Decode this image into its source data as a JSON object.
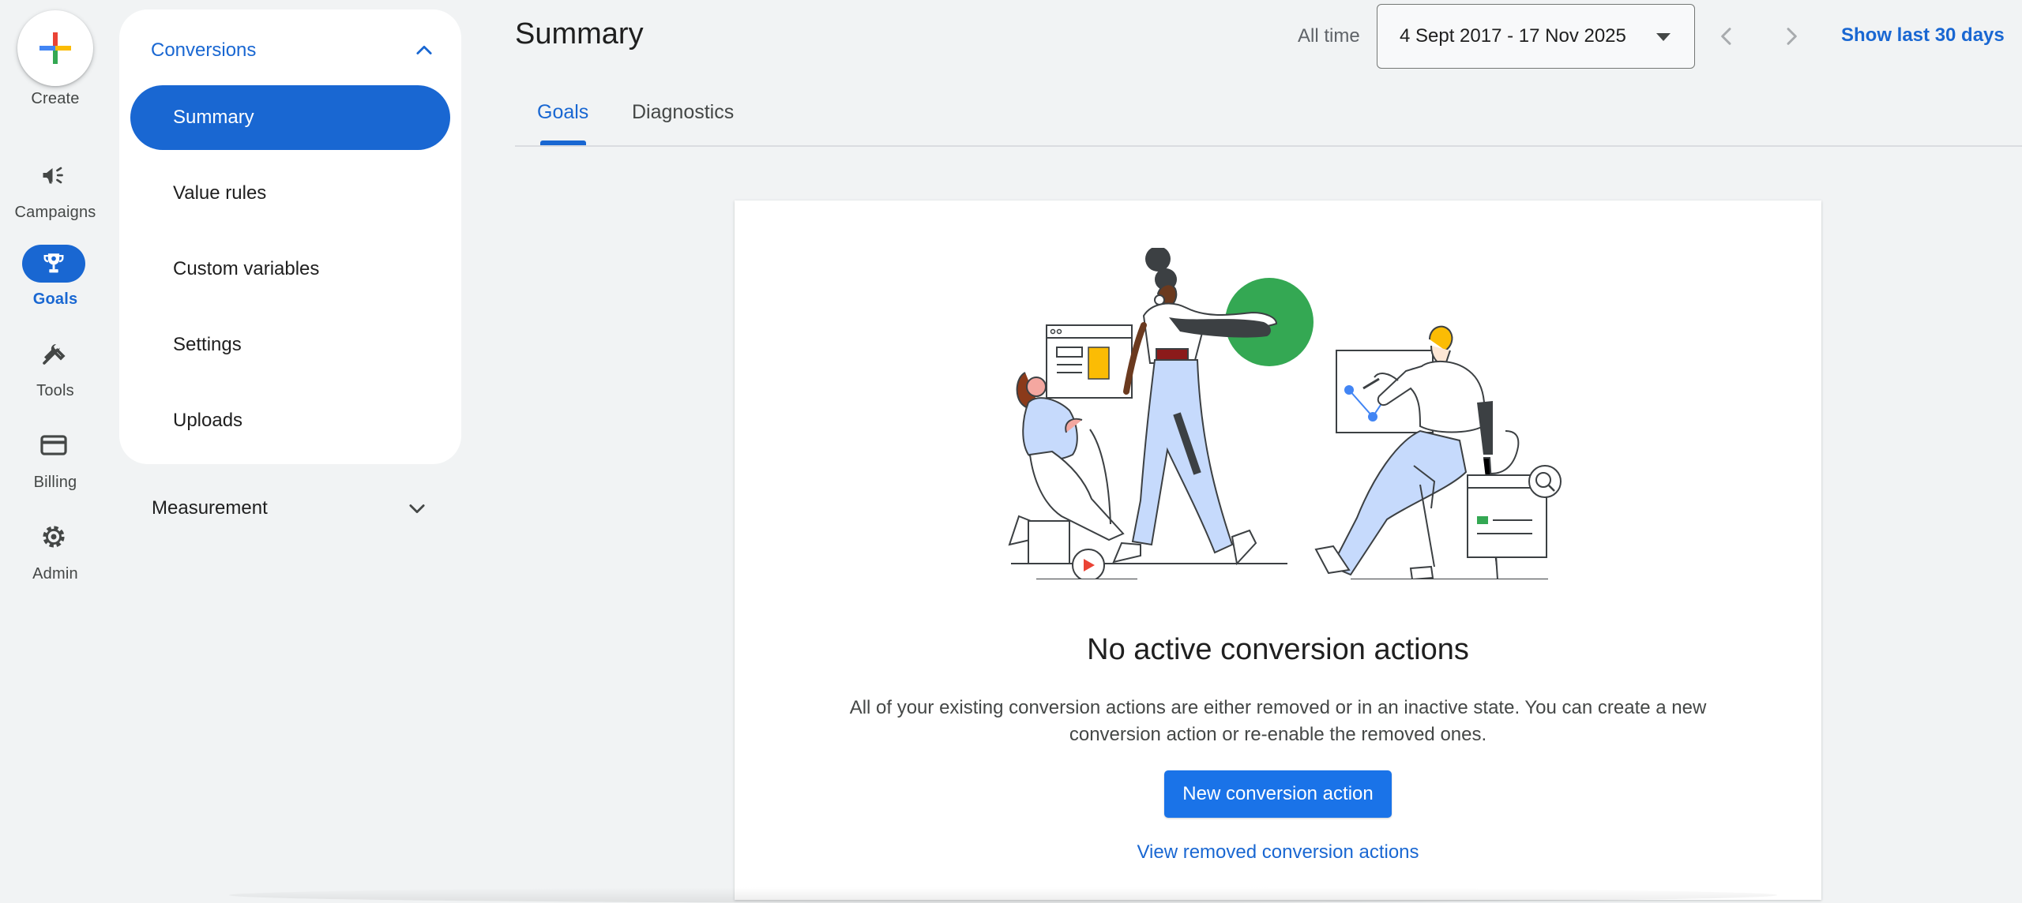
{
  "rail": {
    "create_label": "Create",
    "items": [
      {
        "label": "Campaigns",
        "icon": "megaphone-icon"
      },
      {
        "label": "Goals",
        "icon": "trophy-icon"
      },
      {
        "label": "Tools",
        "icon": "tools-icon"
      },
      {
        "label": "Billing",
        "icon": "credit-card-icon"
      },
      {
        "label": "Admin",
        "icon": "gear-icon"
      }
    ],
    "active": "Goals"
  },
  "subnav": {
    "section_title": "Conversions",
    "items": [
      {
        "label": "Summary"
      },
      {
        "label": "Value rules"
      },
      {
        "label": "Custom variables"
      },
      {
        "label": "Settings"
      },
      {
        "label": "Uploads"
      }
    ],
    "active": "Summary",
    "collapsed_section": "Measurement"
  },
  "header": {
    "title": "Summary",
    "range_label": "All time",
    "date_range": "4 Sept 2017 - 17 Nov 2025",
    "show_last_label": "Show last 30 days"
  },
  "tabs": [
    {
      "label": "Goals"
    },
    {
      "label": "Diagnostics"
    }
  ],
  "empty_state": {
    "title": "No active conversion actions",
    "description": "All of your existing conversion actions are either removed or in an inactive state. You can create a new conversion action or re-enable the removed ones.",
    "primary_button": "New conversion action",
    "secondary_link": "View removed conversion actions"
  },
  "colors": {
    "accent": "#1967d2",
    "button": "#1a73e8",
    "background": "#f1f3f4",
    "illus_green": "#34a853",
    "illus_blue": "#4285f4",
    "illus_yellow": "#fbbc04",
    "illus_red": "#ea4335"
  }
}
